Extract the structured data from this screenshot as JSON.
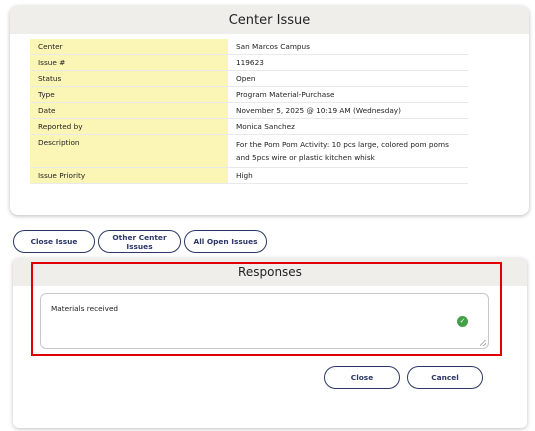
{
  "issue": {
    "title": "Center Issue",
    "fields": [
      {
        "label": "Center",
        "value": "San Marcos Campus"
      },
      {
        "label": "Issue #",
        "value": "119623"
      },
      {
        "label": "Status",
        "value": "Open"
      },
      {
        "label": "Type",
        "value": "Program Material-Purchase"
      },
      {
        "label": "Date",
        "value": "November 5, 2025 @ 10:19 AM (Wednesday)"
      },
      {
        "label": "Reported by",
        "value": "Monica Sanchez"
      },
      {
        "label": "Description",
        "value": "For the Pom Pom Activity: 10 pcs large, colored pom poms and 5pcs wire or plastic kitchen whisk"
      },
      {
        "label": "Issue Priority",
        "value": "High"
      }
    ]
  },
  "actions": {
    "close_issue": "Close Issue",
    "other_center_issues": "Other Center Issues",
    "all_open_issues": "All Open Issues"
  },
  "responses": {
    "title": "Responses",
    "text": "Materials received",
    "check_icon": "check-circle-icon",
    "check_color": "#43a047"
  },
  "dialog": {
    "close_label": "Close",
    "cancel_label": "Cancel"
  },
  "colors": {
    "label_bg": "#fbf5b6",
    "header_bg": "#f0eeea",
    "button_border": "#2c3766",
    "highlight": "#e00000"
  }
}
